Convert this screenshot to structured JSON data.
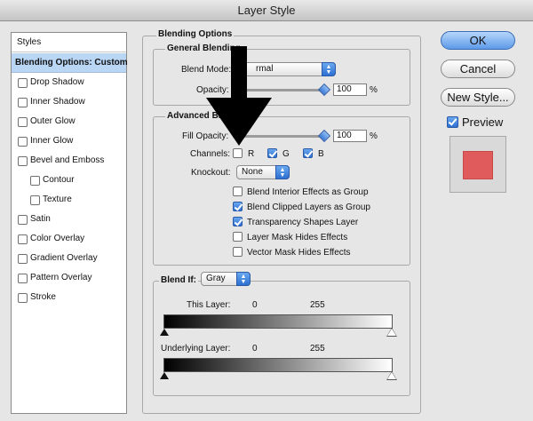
{
  "window": {
    "title": "Layer Style"
  },
  "sidebar": {
    "header": "Styles",
    "items": [
      {
        "label": "Blending Options: Custom",
        "checkbox": false,
        "selected": true,
        "indent": false
      },
      {
        "label": "Drop Shadow",
        "checkbox": true,
        "checked": false,
        "indent": false
      },
      {
        "label": "Inner Shadow",
        "checkbox": true,
        "checked": false,
        "indent": false
      },
      {
        "label": "Outer Glow",
        "checkbox": true,
        "checked": false,
        "indent": false
      },
      {
        "label": "Inner Glow",
        "checkbox": true,
        "checked": false,
        "indent": false
      },
      {
        "label": "Bevel and Emboss",
        "checkbox": true,
        "checked": false,
        "indent": false
      },
      {
        "label": "Contour",
        "checkbox": true,
        "checked": false,
        "indent": true
      },
      {
        "label": "Texture",
        "checkbox": true,
        "checked": false,
        "indent": true
      },
      {
        "label": "Satin",
        "checkbox": true,
        "checked": false,
        "indent": false
      },
      {
        "label": "Color Overlay",
        "checkbox": true,
        "checked": false,
        "indent": false
      },
      {
        "label": "Gradient Overlay",
        "checkbox": true,
        "checked": false,
        "indent": false
      },
      {
        "label": "Pattern Overlay",
        "checkbox": true,
        "checked": false,
        "indent": false
      },
      {
        "label": "Stroke",
        "checkbox": true,
        "checked": false,
        "indent": false
      }
    ]
  },
  "blending": {
    "title": "Blending Options",
    "general": {
      "title": "General Blending",
      "blend_mode_label": "Blend Mode:",
      "blend_mode_value": "Normal",
      "blend_mode_visible": "rmal",
      "opacity_label": "Opacity:",
      "opacity_value": "100",
      "opacity_unit": "%",
      "opacity_level": 1.0
    },
    "advanced": {
      "title": "Advanced Blending",
      "fill_opacity_label": "Fill Opacity:",
      "fill_opacity_value": "100",
      "fill_opacity_unit": "%",
      "fill_opacity_level": 1.0,
      "channels_label": "Channels:",
      "channels": [
        {
          "label": "R",
          "checked": false
        },
        {
          "label": "G",
          "checked": true
        },
        {
          "label": "B",
          "checked": true
        }
      ],
      "knockout_label": "Knockout:",
      "knockout_value": "None",
      "options": [
        {
          "label": "Blend Interior Effects as Group",
          "checked": false
        },
        {
          "label": "Blend Clipped Layers as Group",
          "checked": true
        },
        {
          "label": "Transparency Shapes Layer",
          "checked": true
        },
        {
          "label": "Layer Mask Hides Effects",
          "checked": false
        },
        {
          "label": "Vector Mask Hides Effects",
          "checked": false
        }
      ]
    },
    "blend_if": {
      "label": "Blend If:",
      "value": "Gray",
      "this_layer_label": "This Layer:",
      "this_layer_low": "0",
      "this_layer_high": "255",
      "underlying_label": "Underlying Layer:",
      "underlying_low": "0",
      "underlying_high": "255"
    }
  },
  "buttons": {
    "ok": "OK",
    "cancel": "Cancel",
    "new_style": "New Style..."
  },
  "preview": {
    "label": "Preview",
    "checked": true,
    "swatch_color": "#e05c5c"
  },
  "colors": {
    "accent": "#2d6fd3",
    "selection": "#b9d6f5"
  }
}
